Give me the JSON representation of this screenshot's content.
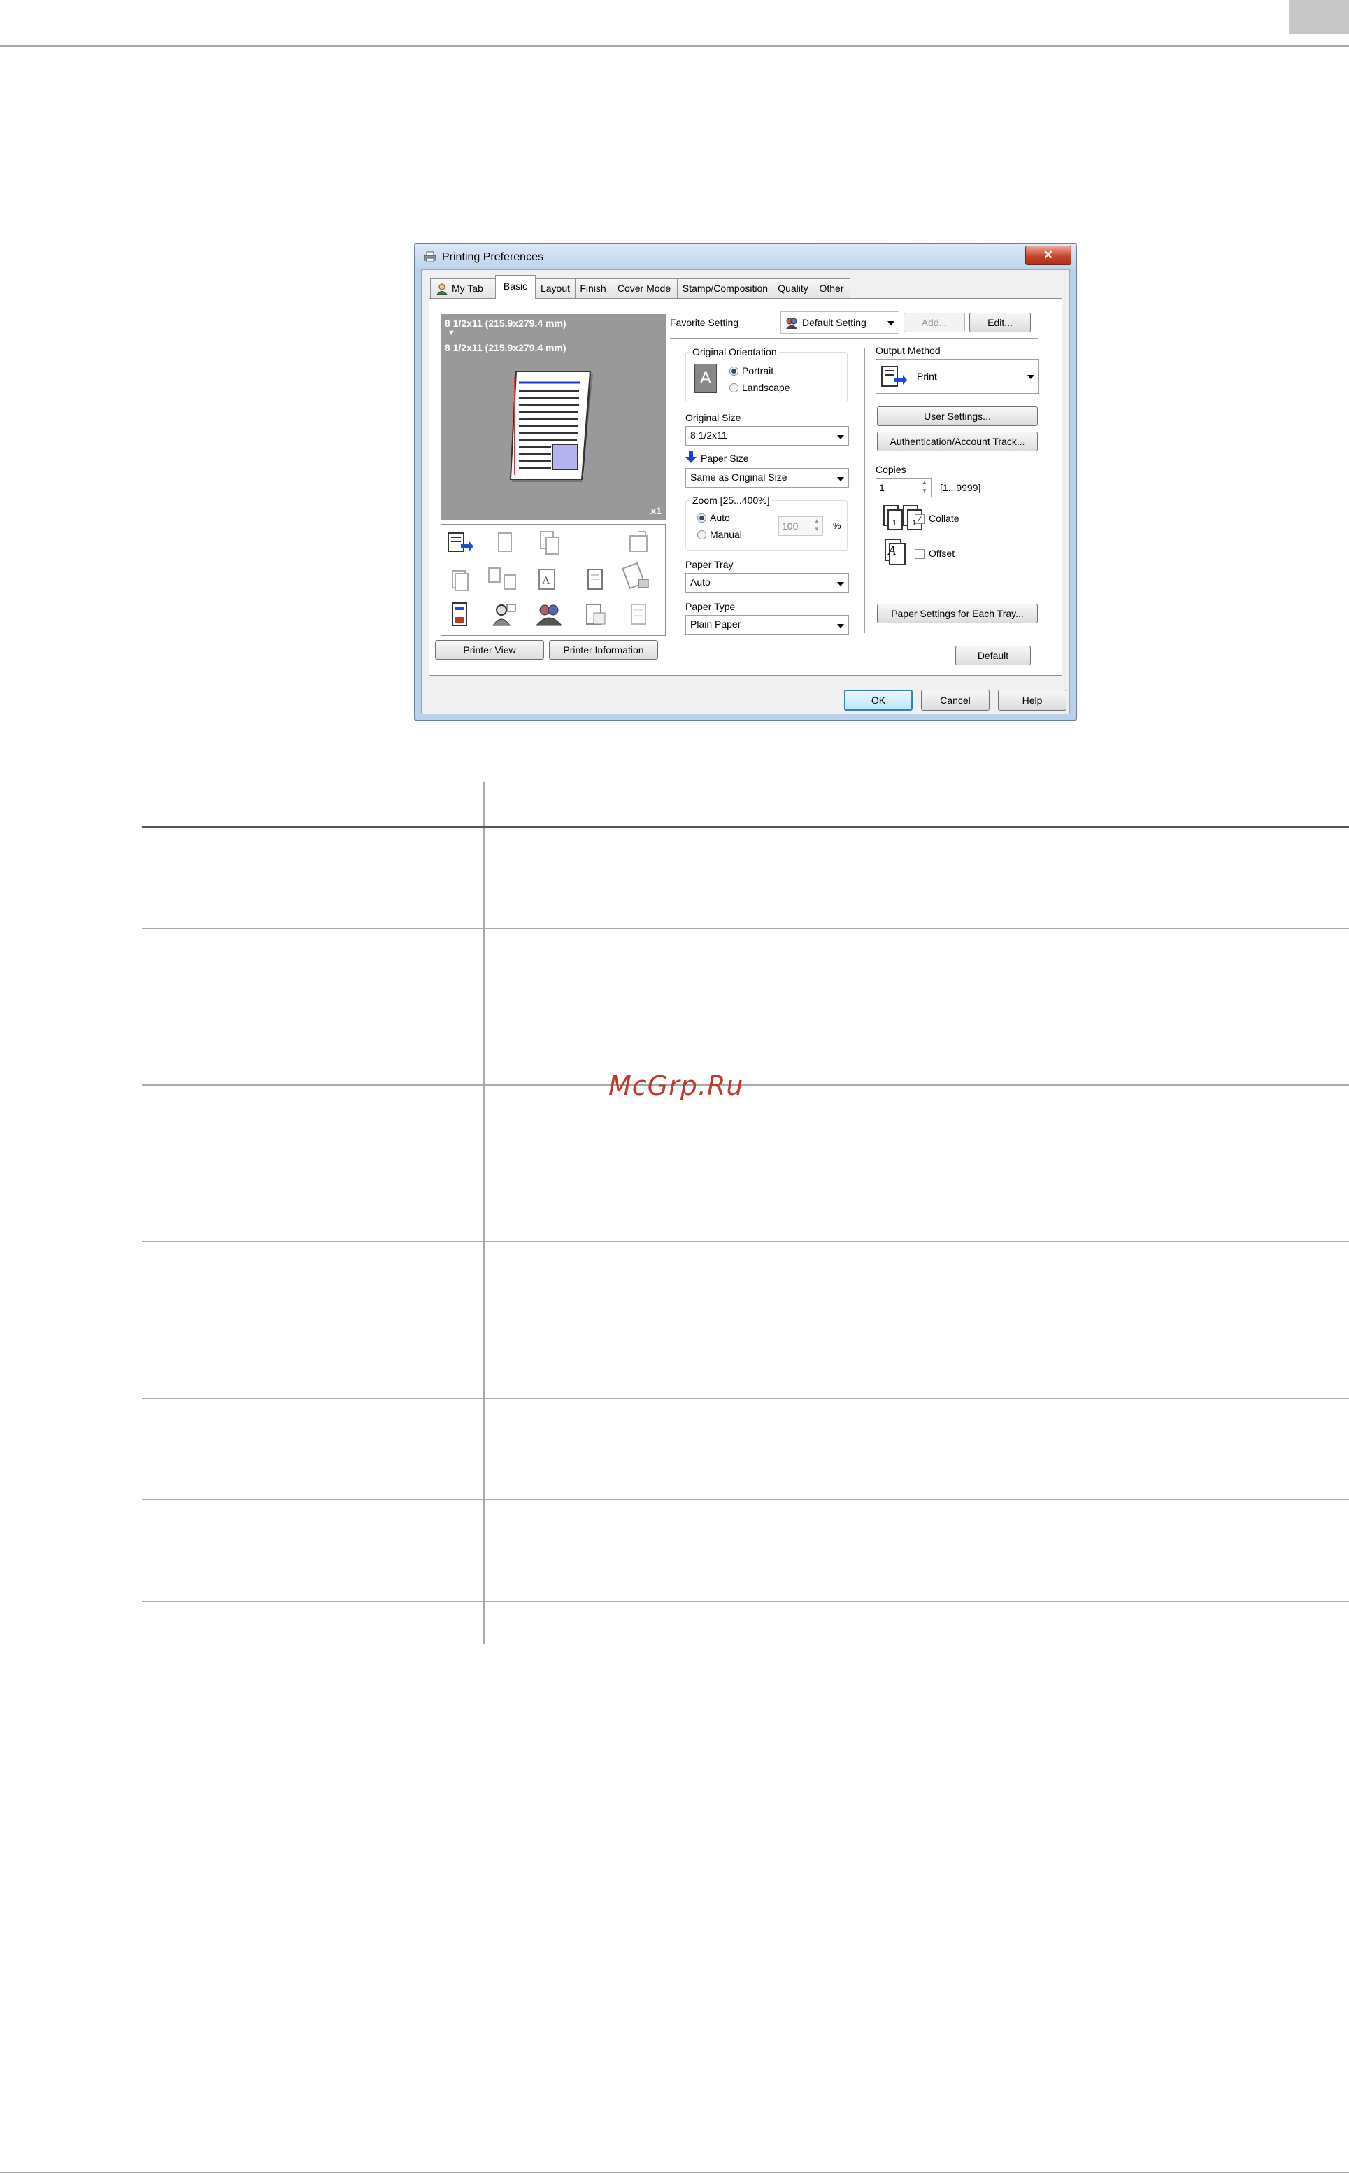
{
  "window": {
    "title": "Printing Preferences",
    "close_glyph": "✕",
    "printer_icon": "printer-icon"
  },
  "tabs": [
    {
      "label": "My Tab"
    },
    {
      "label": "Basic"
    },
    {
      "label": "Layout"
    },
    {
      "label": "Finish"
    },
    {
      "label": "Cover Mode"
    },
    {
      "label": "Stamp/Composition"
    },
    {
      "label": "Quality"
    },
    {
      "label": "Other"
    }
  ],
  "preview": {
    "original_size": "8 1/2x11 (215.9x279.4 mm)",
    "arrow": "▼",
    "paper_size": "8 1/2x11 (215.9x279.4 mm)",
    "copies_badge": "x1"
  },
  "left_buttons": {
    "printer_view": "Printer View",
    "printer_information": "Printer Information"
  },
  "favorite": {
    "label": "Favorite Setting",
    "value": "Default Setting",
    "add": "Add...",
    "edit": "Edit..."
  },
  "orientation": {
    "label": "Original Orientation",
    "portrait": "Portrait",
    "landscape": "Landscape",
    "selected": "Portrait",
    "icon_letter": "A"
  },
  "original_size": {
    "label": "Original Size",
    "value": "8 1/2x11"
  },
  "paper_size": {
    "label": "Paper Size",
    "value": "Same as Original Size"
  },
  "zoom": {
    "label": "Zoom [25...400%]",
    "auto": "Auto",
    "manual": "Manual",
    "value": "100",
    "unit": "%",
    "selected": "Auto"
  },
  "paper_tray": {
    "label": "Paper Tray",
    "value": "Auto"
  },
  "paper_type": {
    "label": "Paper Type",
    "value": "Plain Paper"
  },
  "output_method": {
    "label": "Output Method",
    "value": "Print"
  },
  "right_buttons": {
    "user_settings": "User Settings...",
    "authentication": "Authentication/Account Track...",
    "paper_settings": "Paper Settings for Each Tray...",
    "default": "Default"
  },
  "copies": {
    "label": "Copies",
    "value": "1",
    "range": "[1...9999]",
    "collate": "Collate",
    "collate_checked": true,
    "offset": "Offset",
    "offset_checked": false
  },
  "dialog_buttons": {
    "ok": "OK",
    "cancel": "Cancel",
    "help": "Help"
  },
  "watermark": "McGrp.Ru"
}
